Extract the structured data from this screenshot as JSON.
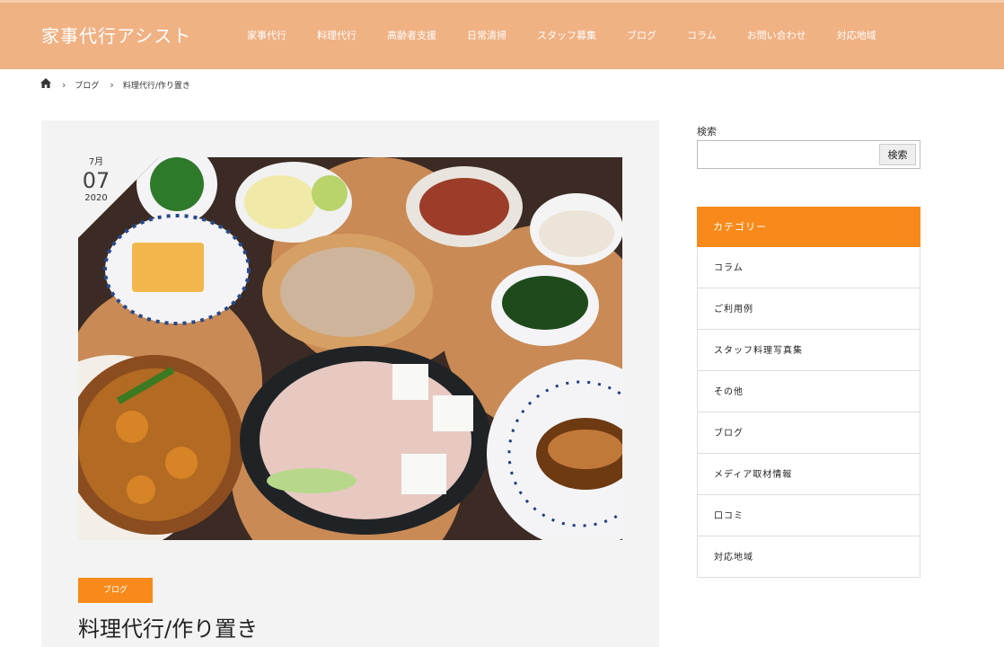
{
  "site": {
    "title": "家事代行アシスト"
  },
  "nav": {
    "items": [
      {
        "label": "家事代行"
      },
      {
        "label": "料理代行"
      },
      {
        "label": "高齢者支援"
      },
      {
        "label": "日常清掃"
      },
      {
        "label": "スタッフ募集"
      },
      {
        "label": "ブログ"
      },
      {
        "label": "コラム"
      },
      {
        "label": "お問い合わせ"
      },
      {
        "label": "対応地域"
      }
    ]
  },
  "breadcrumb": {
    "home_icon": "home-icon",
    "items": [
      {
        "label": "ブログ"
      },
      {
        "label": "料理代行/作り置き"
      }
    ]
  },
  "post": {
    "date": {
      "month": "7月",
      "day": "07",
      "year": "2020"
    },
    "category": "ブログ",
    "title": "料理代行/作り置き"
  },
  "sidebar": {
    "search": {
      "label": "検索",
      "button": "検索",
      "value": ""
    },
    "categories": {
      "heading": "カテゴリー",
      "items": [
        {
          "label": "コラム"
        },
        {
          "label": "ご利用例"
        },
        {
          "label": "スタッフ料理写真集"
        },
        {
          "label": "その他"
        },
        {
          "label": "ブログ"
        },
        {
          "label": "メディア取材情報"
        },
        {
          "label": "口コミ"
        },
        {
          "label": "対応地域"
        }
      ]
    }
  },
  "colors": {
    "header": "#f0b183",
    "accent": "#f78a1a"
  }
}
